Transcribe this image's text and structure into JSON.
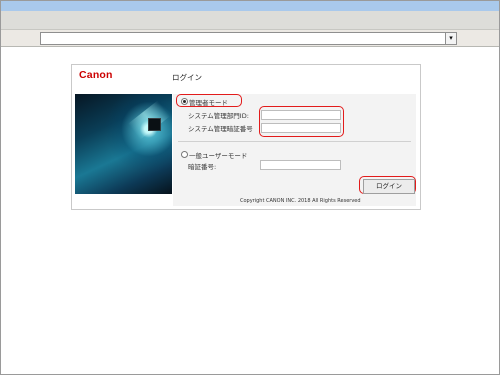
{
  "header": {
    "address_dropdown_glyph": "▾"
  },
  "login_panel": {
    "brand": "Canon",
    "title": "ログイン",
    "admin_mode_label": "管理者モード",
    "system_dept_id_label": "システム管理部門ID:",
    "system_password_label": "システム管理暗証番号",
    "general_user_mode_label": "一般ユーザーモード",
    "password_label": "暗証番号:",
    "login_button": "ログイン",
    "copyright": "Copyright CANON INC. 2018 All Rights Reserved"
  },
  "colors": {
    "brand_red": "#cc0000",
    "highlight_red": "#e21b1b"
  },
  "icons": [
    "dropdown-arrow-icon",
    "radio-button-icon"
  ]
}
